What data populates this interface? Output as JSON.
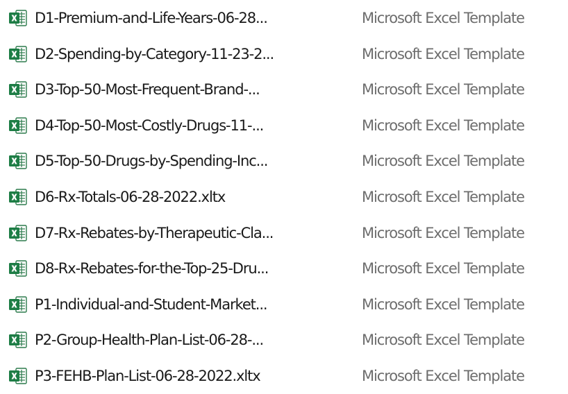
{
  "file_list": {
    "rows": [
      {
        "name": "D1-Premium-and-Life-Years-06-28...",
        "type": "Microsoft Excel Template",
        "icon": "excel-icon"
      },
      {
        "name": "D2-Spending-by-Category-11-23-2...",
        "type": "Microsoft Excel Template",
        "icon": "excel-icon"
      },
      {
        "name": "D3-Top-50-Most-Frequent-Brand-...",
        "type": "Microsoft Excel Template",
        "icon": "excel-icon"
      },
      {
        "name": "D4-Top-50-Most-Costly-Drugs-11-...",
        "type": "Microsoft Excel Template",
        "icon": "excel-icon"
      },
      {
        "name": "D5-Top-50-Drugs-by-Spending-Inc...",
        "type": "Microsoft Excel Template",
        "icon": "excel-icon"
      },
      {
        "name": "D6-Rx-Totals-06-28-2022.xltx",
        "type": "Microsoft Excel Template",
        "icon": "excel-icon"
      },
      {
        "name": "D7-Rx-Rebates-by-Therapeutic-Cla...",
        "type": "Microsoft Excel Template",
        "icon": "excel-icon"
      },
      {
        "name": "D8-Rx-Rebates-for-the-Top-25-Dru...",
        "type": "Microsoft Excel Template",
        "icon": "excel-icon"
      },
      {
        "name": "P1-Individual-and-Student-Market...",
        "type": "Microsoft Excel Template",
        "icon": "excel-icon"
      },
      {
        "name": "P2-Group-Health-Plan-List-06-28-...",
        "type": "Microsoft Excel Template",
        "icon": "excel-icon"
      },
      {
        "name": "P3-FEHB-Plan-List-06-28-2022.xltx",
        "type": "Microsoft Excel Template",
        "icon": "excel-icon"
      }
    ]
  },
  "colors": {
    "excel_green": "#1d7d45",
    "excel_dark_green": "#185c37",
    "name_text": "#1a1a1a",
    "type_text": "#6d6d6d"
  }
}
